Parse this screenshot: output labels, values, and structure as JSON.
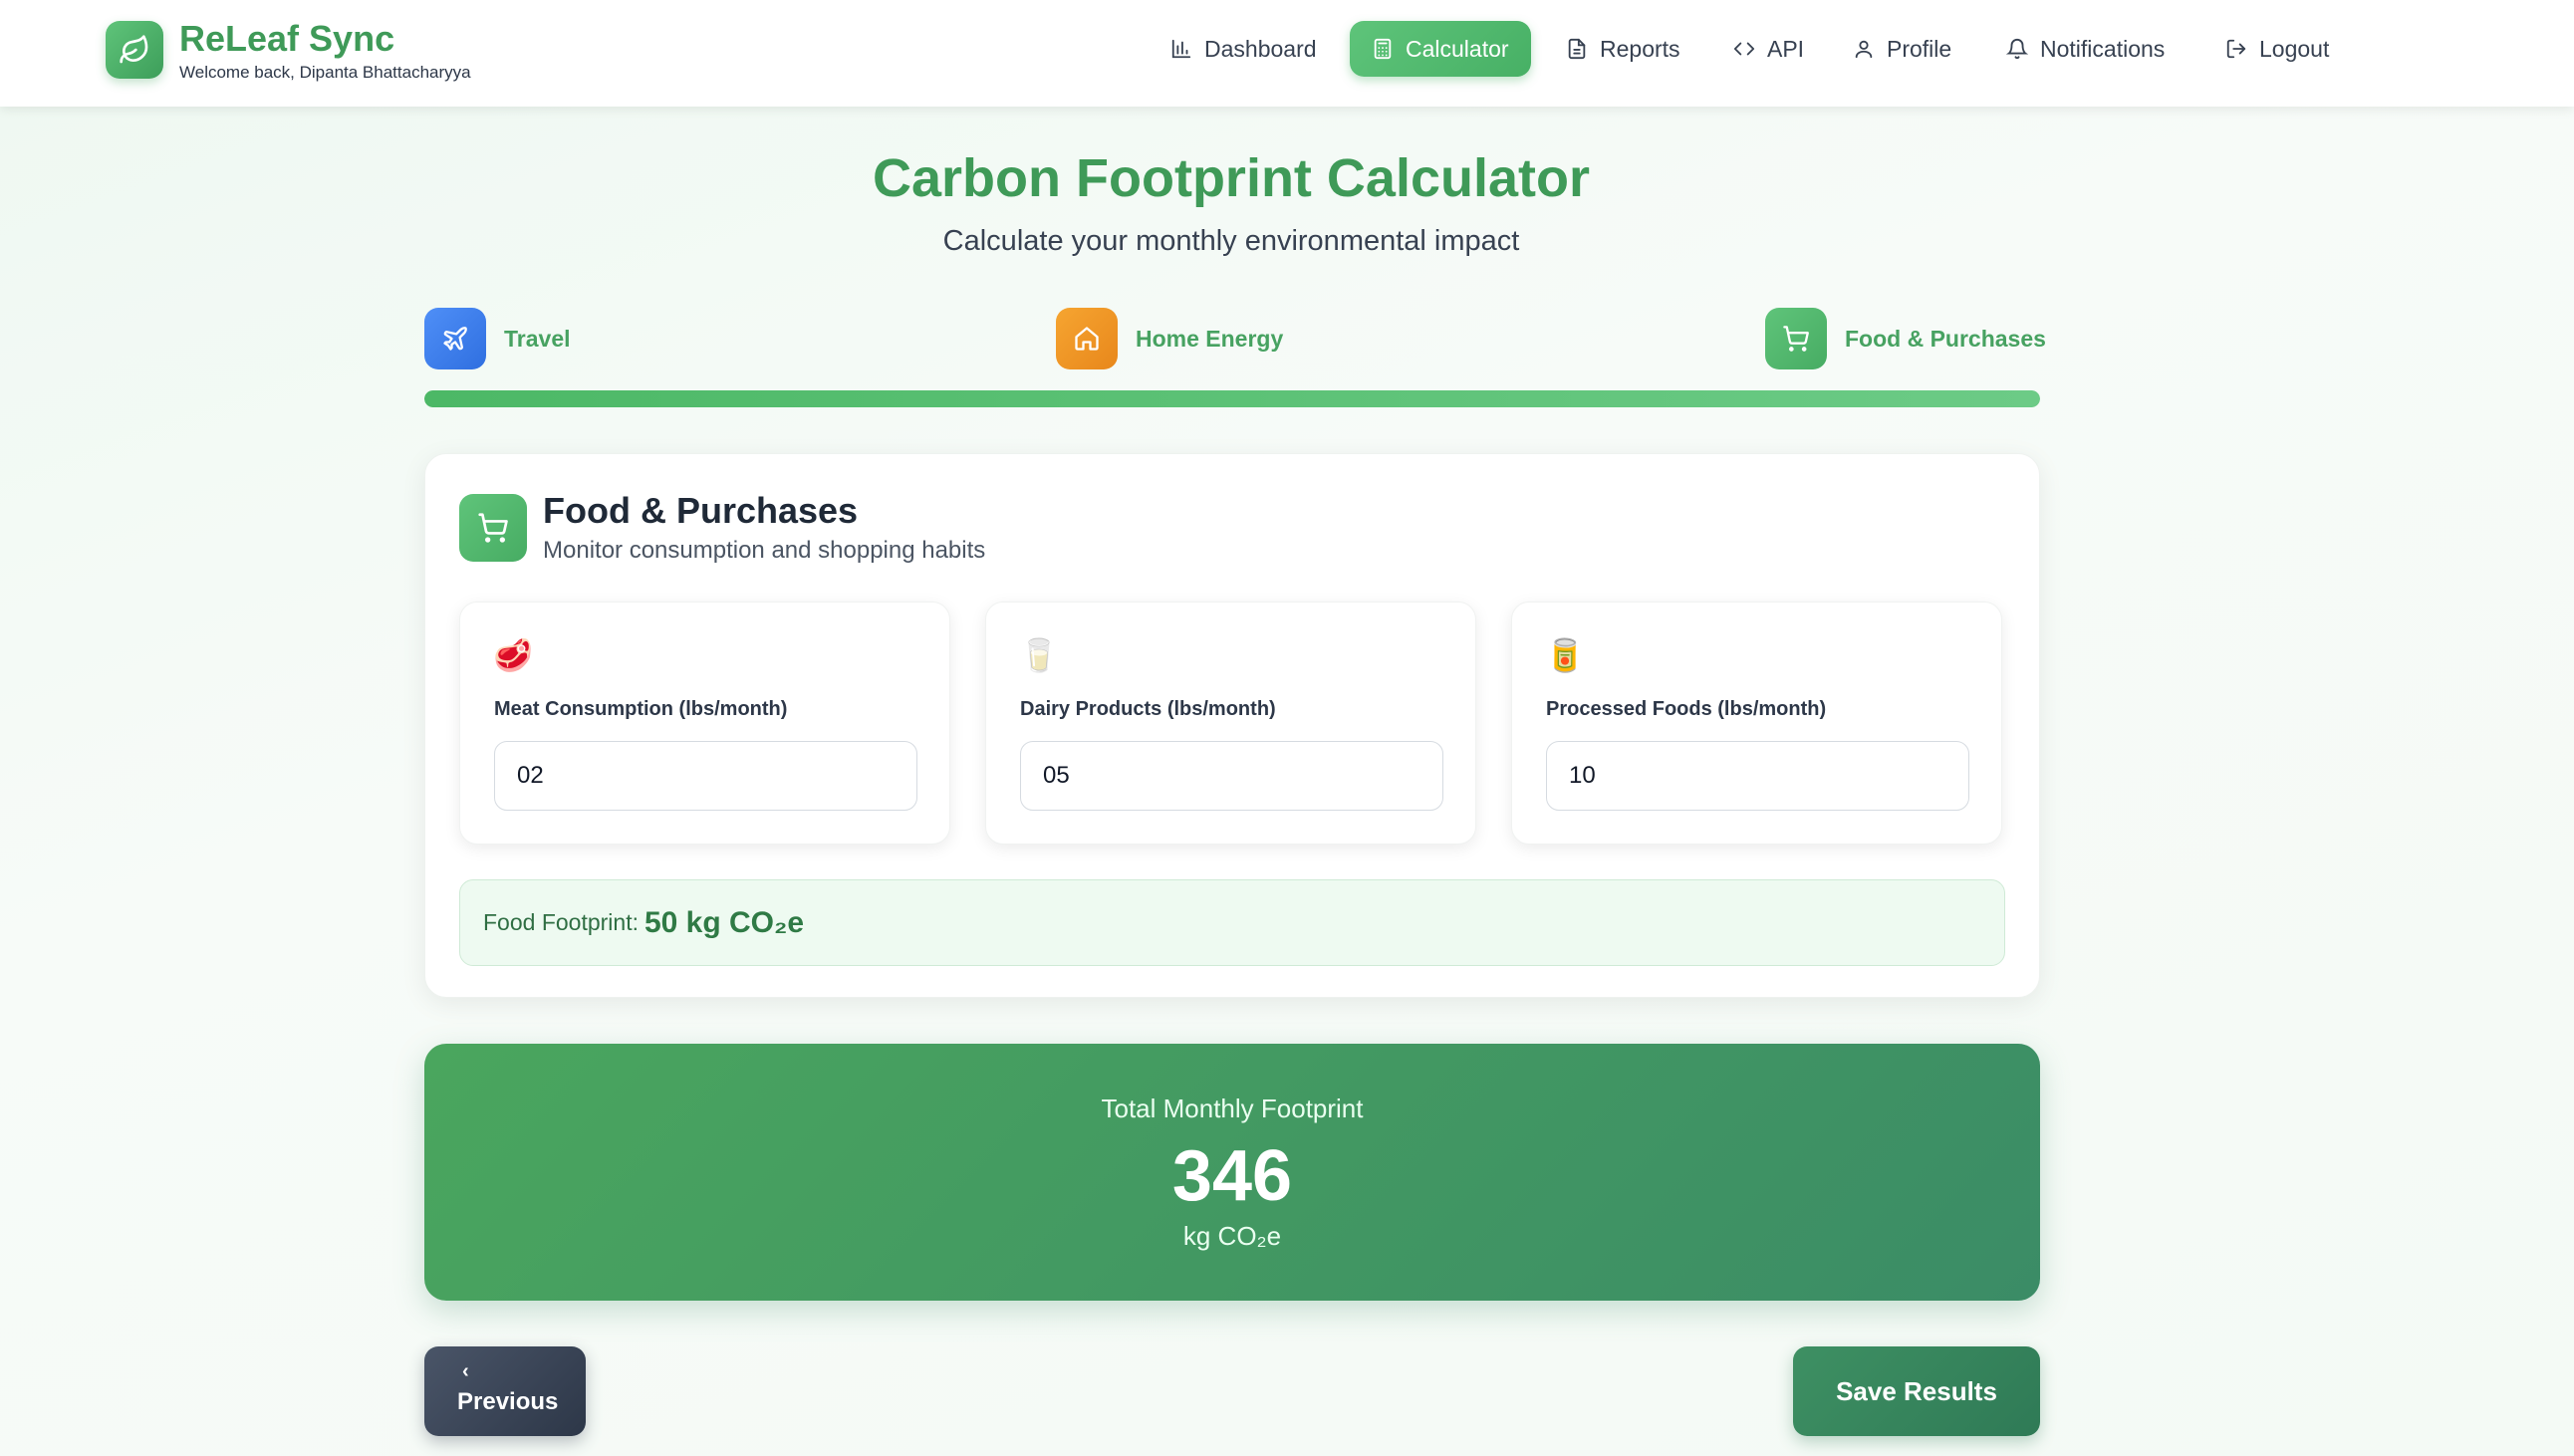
{
  "app": {
    "name": "ReLeaf Sync",
    "welcome": "Welcome back, Dipanta Bhattacharyya"
  },
  "nav": {
    "items": [
      {
        "label": "Dashboard",
        "icon": "bar-chart-icon"
      },
      {
        "label": "Calculator",
        "icon": "calculator-icon",
        "active": true
      },
      {
        "label": "Reports",
        "icon": "document-icon"
      },
      {
        "label": "API",
        "icon": "code-icon"
      },
      {
        "label": "Profile",
        "icon": "user-icon"
      },
      {
        "label": "Notifications",
        "icon": "bell-icon"
      },
      {
        "label": "Logout",
        "icon": "logout-icon"
      }
    ]
  },
  "page": {
    "title": "Carbon Footprint Calculator",
    "subtitle": "Calculate your monthly environmental impact"
  },
  "steps": [
    {
      "label": "Travel",
      "icon": "plane-icon",
      "color": "#3b82f6"
    },
    {
      "label": "Home Energy",
      "icon": "home-icon",
      "color": "#f59e0b"
    },
    {
      "label": "Food & Purchases",
      "icon": "cart-icon",
      "color": "#4caf6a"
    }
  ],
  "progress": {
    "fraction": 1.0
  },
  "section": {
    "title": "Food & Purchases",
    "subtitle": "Monitor consumption and shopping habits",
    "fields": [
      {
        "emoji": "🥩",
        "icon": "meat-icon",
        "label": "Meat Consumption (lbs/month)",
        "value": "02"
      },
      {
        "emoji": "🥛",
        "icon": "milk-icon",
        "label": "Dairy Products (lbs/month)",
        "value": "05"
      },
      {
        "emoji": "🥫",
        "icon": "can-icon",
        "label": "Processed Foods (lbs/month)",
        "value": "10"
      }
    ],
    "summary_label": "Food Footprint:",
    "summary_value": "50 kg CO₂e"
  },
  "total": {
    "label": "Total Monthly Footprint",
    "value": "346",
    "unit": "kg CO₂e"
  },
  "buttons": {
    "previous_chevron": "‹",
    "previous": "Previous",
    "save": "Save Results"
  },
  "colors": {
    "brand_green": "#3f9a58",
    "accent_green": "#47b065",
    "dark_button": "#2d3748"
  }
}
